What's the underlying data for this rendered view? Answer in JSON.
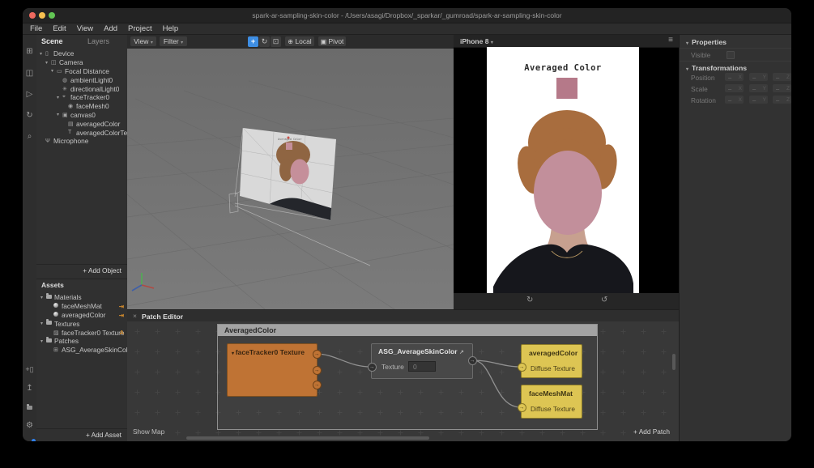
{
  "window": {
    "title": "spark-ar-sampling-skin-color - /Users/asagi/Dropbox/_sparkar/_gumroad/spark-ar-sampling-skin-color"
  },
  "menu_bar": {
    "items": [
      "File",
      "Edit",
      "View",
      "Add",
      "Project",
      "Help"
    ]
  },
  "scene_panel": {
    "tab_scene": "Scene",
    "tab_layers": "Layers",
    "items": [
      {
        "label": "Device"
      },
      {
        "label": "Camera"
      },
      {
        "label": "Focal Distance"
      },
      {
        "label": "ambientLight0"
      },
      {
        "label": "directionalLight0"
      },
      {
        "label": "faceTracker0"
      },
      {
        "label": "faceMesh0"
      },
      {
        "label": "canvas0"
      },
      {
        "label": "averagedColor"
      },
      {
        "label": "averagedColorText"
      },
      {
        "label": "Microphone"
      }
    ],
    "add_object": "+ Add Object"
  },
  "assets_panel": {
    "title": "Assets",
    "items": [
      {
        "label": "Materials",
        "badge": ""
      },
      {
        "label": "faceMeshMat",
        "badge": "⇥"
      },
      {
        "label": "averagedColor",
        "badge": "⇥"
      },
      {
        "label": "Textures",
        "badge": ""
      },
      {
        "label": "faceTracker0 Texture",
        "badge": "A"
      },
      {
        "label": "Patches",
        "badge": ""
      },
      {
        "label": "ASG_AverageSkinColor",
        "badge": ""
      }
    ],
    "add_asset": "+ Add Asset"
  },
  "viewport_toolbar": {
    "view_button": "View",
    "filter_button": "Filter",
    "local_button": "Local",
    "pivot_button": "Pivot"
  },
  "simulator": {
    "device_name": "iPhone 8",
    "screen_title": "Averaged Color",
    "swatch_color": "#b57989"
  },
  "properties_panel": {
    "title": "Properties",
    "visible_label": "Visible",
    "transformations_title": "Transformations",
    "position_label": "Position",
    "scale_label": "Scale",
    "rotation_label": "Rotation",
    "empty_value": "–",
    "axis_x": "X",
    "axis_y": "Y",
    "axis_z": "Z"
  },
  "patch_editor": {
    "tab_title": "Patch Editor",
    "group_title": "AveragedColor",
    "nodes": {
      "texture_source": {
        "title": "faceTracker0 Texture"
      },
      "asg": {
        "title": "ASG_AverageSkinColor",
        "input_label": "Texture",
        "input_value": "0"
      },
      "averaged_color": {
        "title": "averagedColor",
        "port_label": "Diffuse Texture"
      },
      "face_mesh_mat": {
        "title": "faceMeshMat",
        "port_label": "Diffuse Texture"
      }
    },
    "show_map": "Show Map",
    "add_patch": "+ Add Patch"
  },
  "colors": {
    "accent_blue": "#3e8ee3",
    "patch_orange": "#bf7334",
    "patch_yellow": "#ddc553",
    "mask_pink": "#c28f9b",
    "traffic_red": "#ef6a5f",
    "traffic_yellow": "#f6bf50",
    "traffic_green": "#62c554"
  }
}
